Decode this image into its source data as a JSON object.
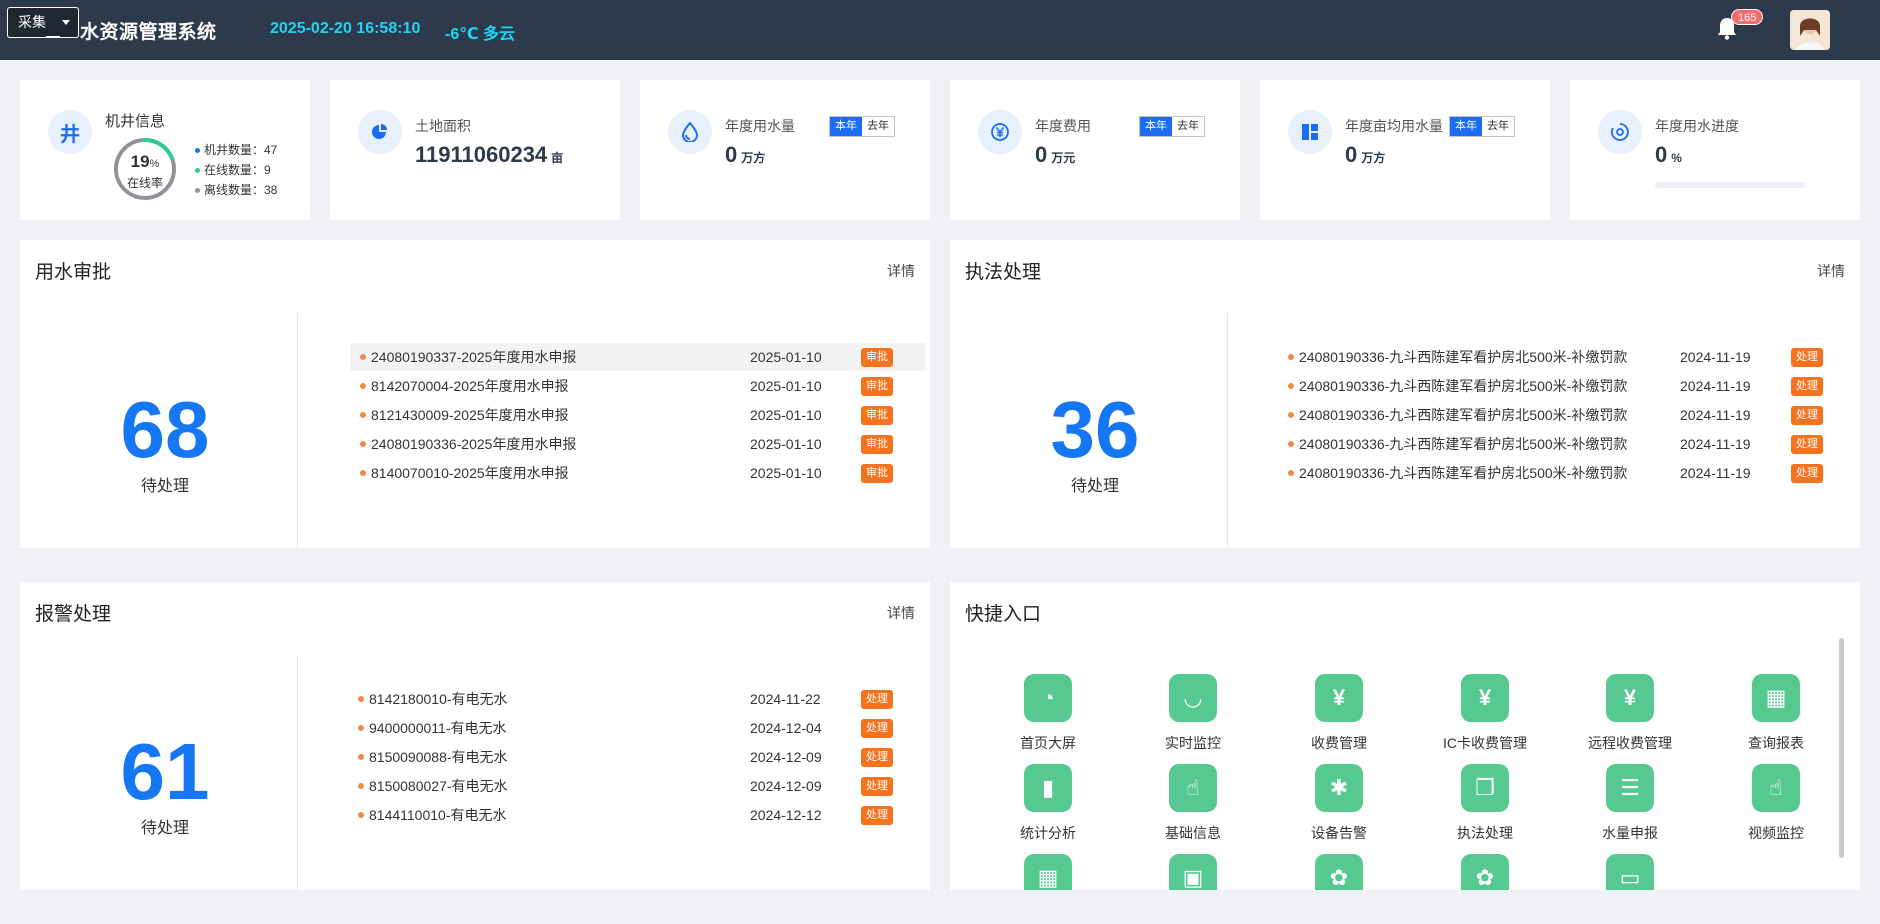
{
  "header": {
    "collect_select": "采集",
    "title": "水资源管理系统",
    "datetime": "2025-02-20 16:58:10",
    "weather": "-6℃ 多云",
    "notification_count": "165",
    "bell_icon": "bell-icon",
    "accent_color": "#1fd5f5",
    "bar_color": "#2d3a4b"
  },
  "well_info": {
    "icon_text": "井",
    "title": "机井信息",
    "online_rate": "19",
    "online_rate_unit": "%",
    "online_rate_label": "在线率",
    "online_rate_fraction": 0.19,
    "well_count": "机井数量：47",
    "online_count": "在线数量：9",
    "offline_count": "离线数量：38"
  },
  "land": {
    "label": "土地面积",
    "value": "11911060234",
    "unit": "亩",
    "icon": "pie-icon"
  },
  "annual_water": {
    "label": "年度用水量",
    "value": "0",
    "unit": "万方",
    "this_year": "本年",
    "last_year": "去年",
    "icon": "water-drop-icon"
  },
  "annual_fee": {
    "label": "年度费用",
    "value": "0",
    "unit": "万元",
    "this_year": "本年",
    "last_year": "去年",
    "icon": "yuan-icon"
  },
  "annual_per_mu": {
    "label": "年度亩均用水量",
    "value": "0",
    "unit": "万方",
    "this_year": "本年",
    "last_year": "去年",
    "icon": "dashboard-icon"
  },
  "annual_progress": {
    "label": "年度用水进度",
    "value": "0",
    "unit": "%",
    "progress_fraction": 0,
    "icon": "progress-icon"
  },
  "approval": {
    "title": "用水审批",
    "detail": "详情",
    "count": "68",
    "count_label": "待处理",
    "items": [
      {
        "text": "24080190337-2025年度用水申报",
        "date": "2025-01-10",
        "action": "审批"
      },
      {
        "text": "8142070004-2025年度用水申报",
        "date": "2025-01-10",
        "action": "审批"
      },
      {
        "text": "8121430009-2025年度用水申报",
        "date": "2025-01-10",
        "action": "审批"
      },
      {
        "text": "24080190336-2025年度用水申报",
        "date": "2025-01-10",
        "action": "审批"
      },
      {
        "text": "8140070010-2025年度用水申报",
        "date": "2025-01-10",
        "action": "审批"
      }
    ]
  },
  "enforcement": {
    "title": "执法处理",
    "detail": "详情",
    "count": "36",
    "count_label": "待处理",
    "items": [
      {
        "text": "24080190336-九斗西陈建军看护房北500米-补缴罚款",
        "date": "2024-11-19",
        "action": "处理"
      },
      {
        "text": "24080190336-九斗西陈建军看护房北500米-补缴罚款",
        "date": "2024-11-19",
        "action": "处理"
      },
      {
        "text": "24080190336-九斗西陈建军看护房北500米-补缴罚款",
        "date": "2024-11-19",
        "action": "处理"
      },
      {
        "text": "24080190336-九斗西陈建军看护房北500米-补缴罚款",
        "date": "2024-11-19",
        "action": "处理"
      },
      {
        "text": "24080190336-九斗西陈建军看护房北500米-补缴罚款",
        "date": "2024-11-19",
        "action": "处理"
      }
    ]
  },
  "alarm": {
    "title": "报警处理",
    "detail": "详情",
    "count": "61",
    "count_label": "待处理",
    "items": [
      {
        "text": "8142180010-有电无水",
        "date": "2024-11-22",
        "action": "处理"
      },
      {
        "text": "9400000011-有电无水",
        "date": "2024-12-04",
        "action": "处理"
      },
      {
        "text": "8150090088-有电无水",
        "date": "2024-12-09",
        "action": "处理"
      },
      {
        "text": "8150080027-有电无水",
        "date": "2024-12-09",
        "action": "处理"
      },
      {
        "text": "8144110010-有电无水",
        "date": "2024-12-12",
        "action": "处理"
      }
    ]
  },
  "quick": {
    "title": "快捷入口",
    "items": [
      {
        "label": "首页大屏",
        "glyph": "◔",
        "icon": "speedometer-icon"
      },
      {
        "label": "实时监控",
        "glyph": "◡",
        "icon": "eye-closed-icon"
      },
      {
        "label": "收费管理",
        "glyph": "¥",
        "icon": "yuan-icon"
      },
      {
        "label": "IC卡收费管理",
        "glyph": "¥",
        "icon": "yuan-icon"
      },
      {
        "label": "远程收费管理",
        "glyph": "¥",
        "icon": "yuan-icon"
      },
      {
        "label": "查询报表",
        "glyph": "▦",
        "icon": "table-icon"
      },
      {
        "label": "统计分析",
        "glyph": "▮",
        "icon": "bar-chart-icon"
      },
      {
        "label": "基础信息",
        "glyph": "☝",
        "icon": "pointer-icon"
      },
      {
        "label": "设备告警",
        "glyph": "✱",
        "icon": "bug-icon"
      },
      {
        "label": "执法处理",
        "glyph": "❐",
        "icon": "documents-icon"
      },
      {
        "label": "水量申报",
        "glyph": "☰",
        "icon": "list-icon"
      },
      {
        "label": "视频监控",
        "glyph": "☝",
        "icon": "pointer-icon"
      },
      {
        "label": "",
        "glyph": "▦",
        "icon": "table-icon"
      },
      {
        "label": "",
        "glyph": "▣",
        "icon": "image-icon"
      },
      {
        "label": "",
        "glyph": "✿",
        "icon": "gear-icon"
      },
      {
        "label": "",
        "glyph": "✿",
        "icon": "gear-icon"
      },
      {
        "label": "",
        "glyph": "▭",
        "icon": "monitor-icon"
      }
    ]
  },
  "colors": {
    "primary": "#1677f5",
    "tag_orange": "#f5731e",
    "quick_green": "#55c990",
    "online_green": "#2ecc8f",
    "offline_gray": "#909399"
  }
}
